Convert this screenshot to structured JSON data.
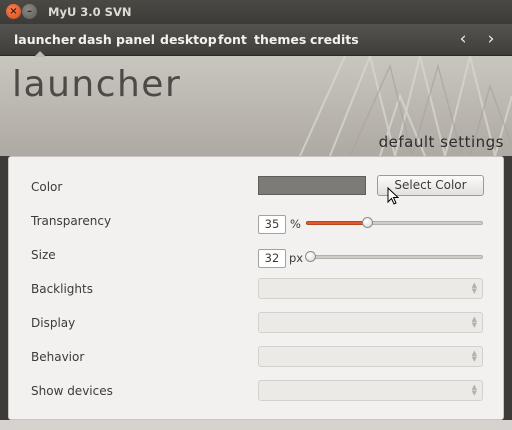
{
  "window": {
    "title": "MyU 3.0 SVN",
    "close_glyph": "×",
    "minimize_glyph": "–"
  },
  "nav": {
    "tabs": [
      "launcher",
      "dash",
      "panel",
      "desktop",
      "font",
      "themes",
      "credits"
    ],
    "active_tab": "launcher",
    "prev_glyph": "‹",
    "next_glyph": "›"
  },
  "header": {
    "title": "launcher",
    "subtitle": "default settings"
  },
  "settings": {
    "color": {
      "label": "Color",
      "swatch_color": "#7c7b78",
      "button_label": "Select Color"
    },
    "transparency": {
      "label": "Transparency",
      "value": "35",
      "unit": "%",
      "slider_fraction": 0.35,
      "accent_color": "#e2592b"
    },
    "size": {
      "label": "Size",
      "value": "32",
      "unit": "px",
      "slider_fraction": 0.0
    },
    "backlights": {
      "label": "Backlights",
      "value": ""
    },
    "display": {
      "label": "Display",
      "value": ""
    },
    "behavior": {
      "label": "Behavior",
      "value": ""
    },
    "show_devices": {
      "label": "Show devices",
      "value": ""
    }
  },
  "icons": {
    "combo_arrows": "combo-arrows-icon",
    "cursor": "mouse-pointer-icon"
  }
}
